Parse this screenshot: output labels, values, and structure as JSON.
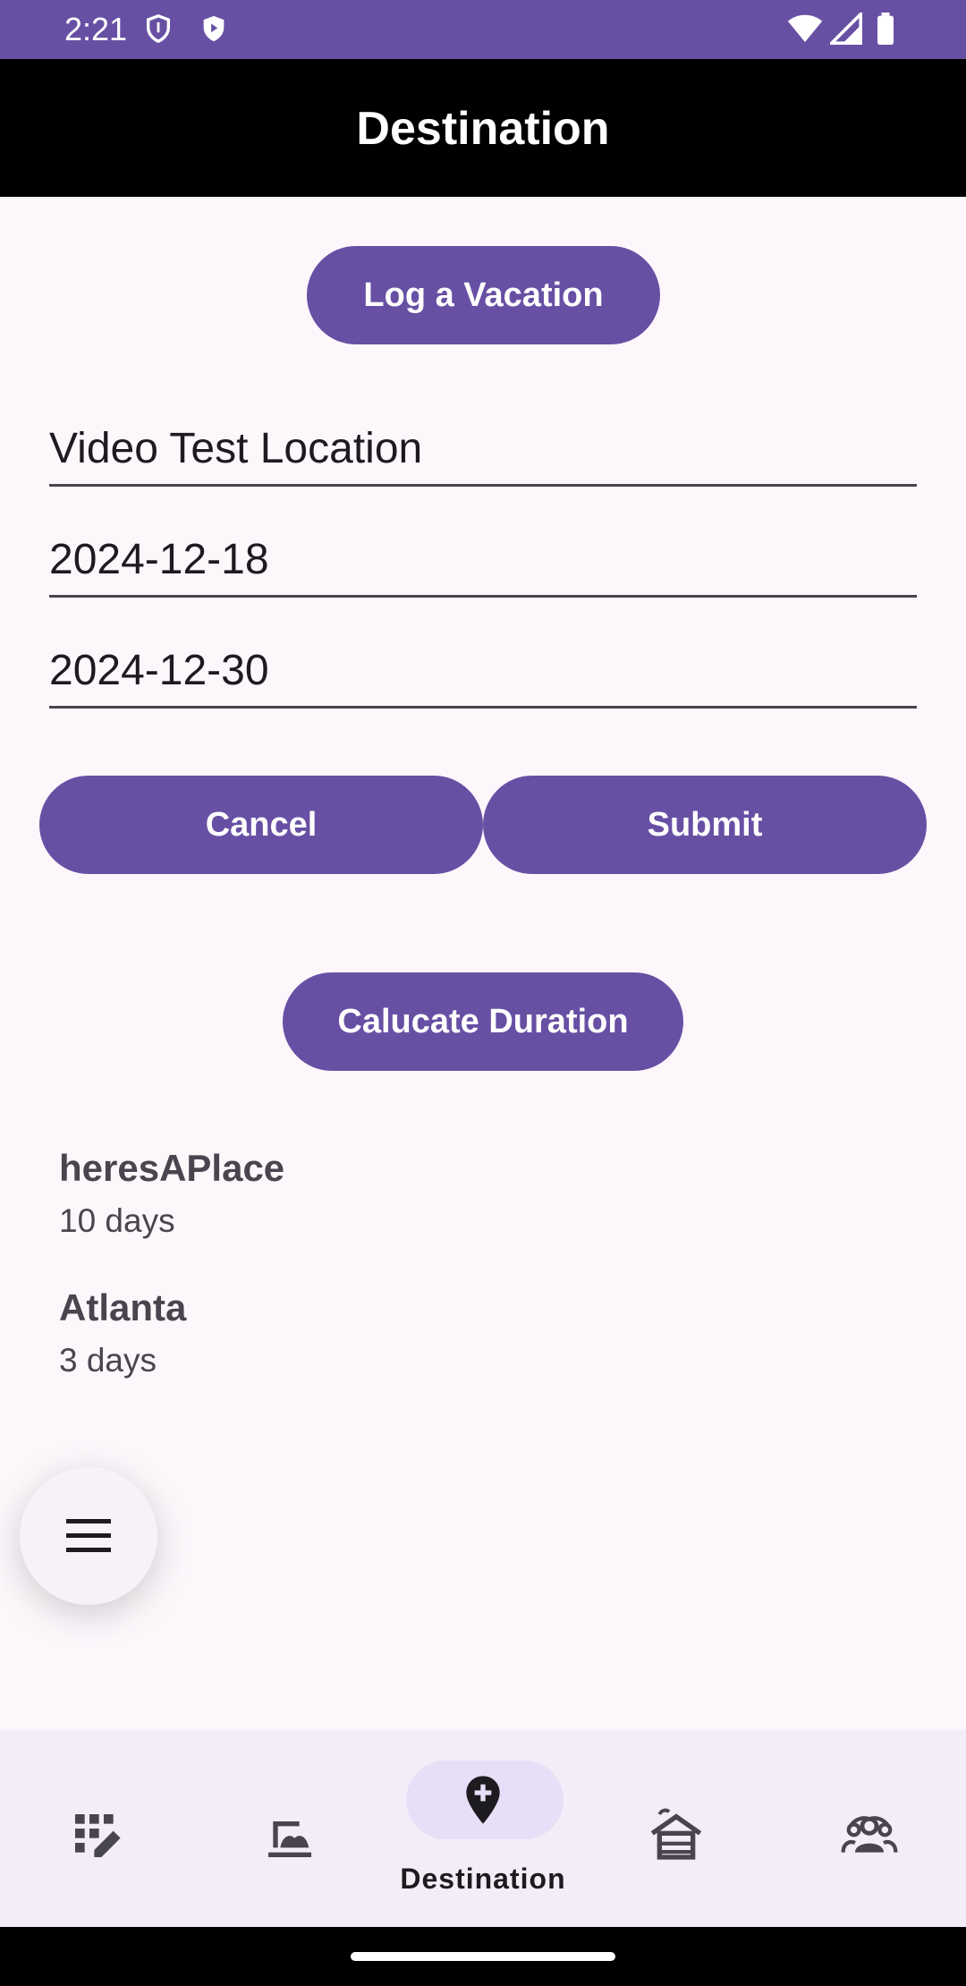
{
  "status_bar": {
    "time": "2:21"
  },
  "app_bar": {
    "title": "Destination"
  },
  "buttons": {
    "log_vacation": "Log a Vacation",
    "cancel": "Cancel",
    "submit": "Submit",
    "calculate": "Calucate Duration"
  },
  "form": {
    "location": "Video Test Location",
    "start_date": "2024-12-18",
    "end_date": "2024-12-30"
  },
  "destinations": [
    {
      "name": "heresAPlace",
      "duration": "10 days"
    },
    {
      "name": "Atlanta",
      "duration": "3 days"
    }
  ],
  "bottom_nav": {
    "active_label": "Destination",
    "items": [
      "edit-grid-icon",
      "boat-landscape-icon",
      "add-location-icon",
      "cabin-icon",
      "group-icon"
    ]
  },
  "colors": {
    "primary": "#6750a4",
    "background": "#fdf7fc",
    "nav_bg": "#f3edf7",
    "indicator": "#e8def8"
  }
}
